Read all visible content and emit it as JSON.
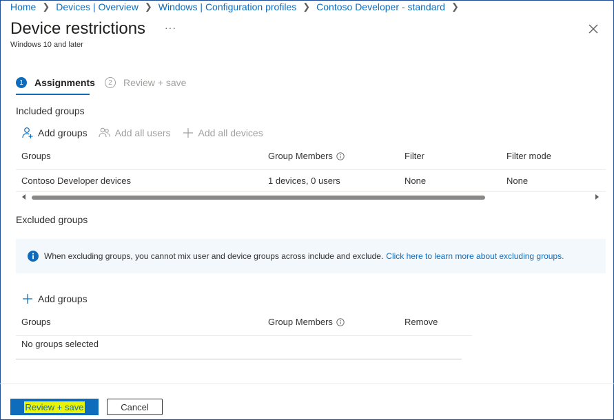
{
  "breadcrumb": [
    "Home",
    "Devices | Overview",
    "Windows | Configuration profiles",
    "Contoso Developer - standard"
  ],
  "header": {
    "title": "Device restrictions",
    "subtitle": "Windows 10 and later",
    "more_label": "···"
  },
  "steps": [
    {
      "num": "1",
      "label": "Assignments",
      "active": true
    },
    {
      "num": "2",
      "label": "Review + save",
      "active": false
    }
  ],
  "included": {
    "title": "Included groups",
    "toolbar": {
      "add_groups": "Add groups",
      "add_all_users": "Add all users",
      "add_all_devices": "Add all devices"
    },
    "columns": [
      "Groups",
      "Group Members",
      "Filter",
      "Filter mode"
    ],
    "rows": [
      {
        "group": "Contoso Developer devices",
        "members": "1 devices, 0 users",
        "filter": "None",
        "filter_mode": "None"
      }
    ]
  },
  "excluded": {
    "title": "Excluded groups",
    "info_text": "When excluding groups, you cannot mix user and device groups across include and exclude.",
    "info_link": "Click here to learn more about excluding groups.",
    "add_groups": "Add groups",
    "columns": [
      "Groups",
      "Group Members",
      "Remove"
    ],
    "empty_text": "No groups selected"
  },
  "footer": {
    "primary": "Review + save",
    "secondary": "Cancel"
  },
  "colors": {
    "accent": "#0f6cbd",
    "highlight": "#e8f30a",
    "banner_bg": "#f3f8fc",
    "border": "#1f4e99"
  },
  "icons": [
    "chevron-right-icon",
    "more-icon",
    "close-icon",
    "add-user-icon",
    "add-users-icon",
    "plus-icon",
    "info-icon",
    "scroll-left-icon",
    "scroll-right-icon"
  ]
}
